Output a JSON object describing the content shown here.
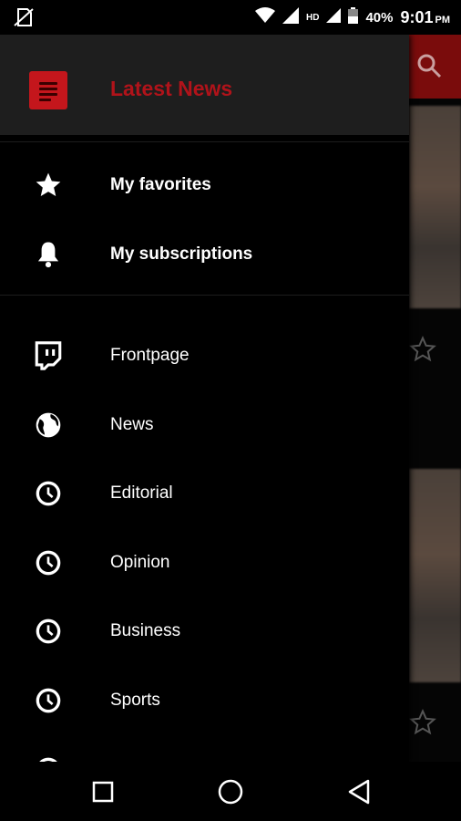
{
  "status_bar": {
    "signal_label": "HD",
    "battery": "40%",
    "time": "9:01",
    "ampm": "PM"
  },
  "drawer": {
    "header_title": "Latest News",
    "personal_items": [
      {
        "label": "My favorites",
        "icon": "star-icon"
      },
      {
        "label": "My subscriptions",
        "icon": "bell-icon"
      }
    ],
    "section_items": [
      {
        "label": "Frontpage",
        "icon": "twitch-icon"
      },
      {
        "label": "News",
        "icon": "globe-icon"
      },
      {
        "label": "Editorial",
        "icon": "clock-icon"
      },
      {
        "label": "Opinion",
        "icon": "clock-icon"
      },
      {
        "label": "Business",
        "icon": "clock-icon"
      },
      {
        "label": "Sports",
        "icon": "clock-icon"
      }
    ]
  },
  "colors": {
    "accent": "#c4161c",
    "title": "#b0131a",
    "header_bg": "#1e1e1e"
  }
}
